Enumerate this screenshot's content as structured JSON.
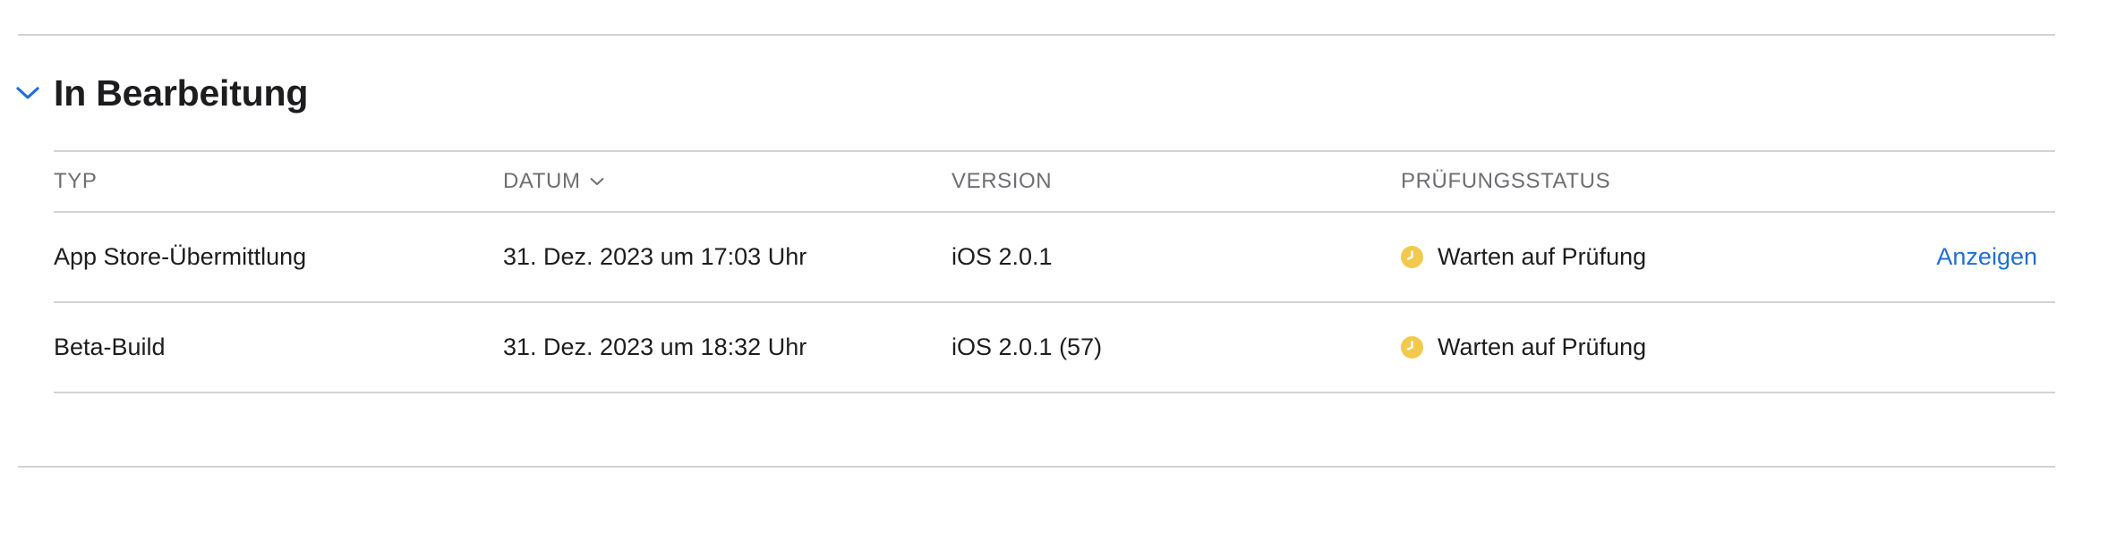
{
  "section": {
    "title": "In Bearbeitung",
    "expanded": true
  },
  "table": {
    "columns": {
      "typ": "TYP",
      "datum": "DATUM",
      "version": "VERSION",
      "status": "PRÜFUNGSSTATUS"
    },
    "sorted_by": "datum",
    "rows": [
      {
        "typ": "App Store-Übermittlung",
        "datum": "31. Dez. 2023 um 17:03 Uhr",
        "version": "iOS 2.0.1",
        "status": "Warten auf Prüfung",
        "status_icon": "clock-icon",
        "action": "Anzeigen"
      },
      {
        "typ": "Beta-Build",
        "datum": "31. Dez. 2023 um 18:32 Uhr",
        "version": "iOS 2.0.1 (57)",
        "status": "Warten auf Prüfung",
        "status_icon": "clock-icon"
      }
    ]
  },
  "colors": {
    "accent": "#1f6fd6",
    "status_pending": "#f2c94c",
    "divider": "#d2d2d7",
    "header_text": "#6e6e73",
    "body_text": "#1d1d1f"
  }
}
